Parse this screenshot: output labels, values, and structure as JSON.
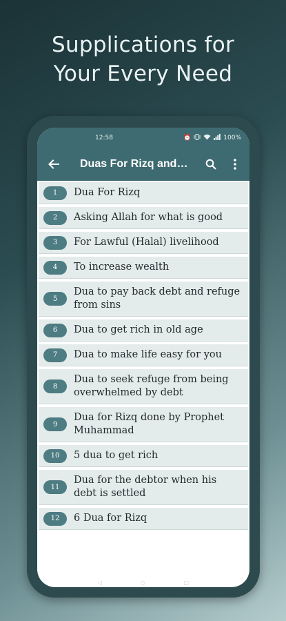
{
  "promo": {
    "title_line1": "Supplications for",
    "title_line2": "Your Every Need"
  },
  "statusbar": {
    "time": "12:58",
    "battery": "100%",
    "icons": [
      "alarm-icon",
      "vibrate-icon",
      "wifi-icon",
      "signal-icon"
    ]
  },
  "toolbar": {
    "title": "Duas For Rizq and Debt",
    "back_icon": "arrow-left-icon",
    "search_icon": "search-icon",
    "more_icon": "more-vert-icon"
  },
  "colors": {
    "accent": "#3e6b71",
    "badge": "#4d7c82",
    "item_bg": "#e4ebeb"
  },
  "items": [
    {
      "num": "1",
      "label": "Dua For Rizq"
    },
    {
      "num": "2",
      "label": "Asking Allah for what is good"
    },
    {
      "num": "3",
      "label": "For Lawful (Halal) livelihood"
    },
    {
      "num": "4",
      "label": "To increase wealth"
    },
    {
      "num": "5",
      "label": "Dua to pay back debt and refuge from sins"
    },
    {
      "num": "6",
      "label": "Dua to get rich in old age"
    },
    {
      "num": "7",
      "label": "Dua to make life easy for you"
    },
    {
      "num": "8",
      "label": "Dua to seek refuge from being overwhelmed by debt"
    },
    {
      "num": "9",
      "label": "Dua for Rizq done by Prophet Muhammad"
    },
    {
      "num": "10",
      "label": "5 dua to get rich"
    },
    {
      "num": "11",
      "label": "Dua for the debtor when his debt is settled"
    },
    {
      "num": "12",
      "label": "6 Dua for Rizq"
    }
  ]
}
